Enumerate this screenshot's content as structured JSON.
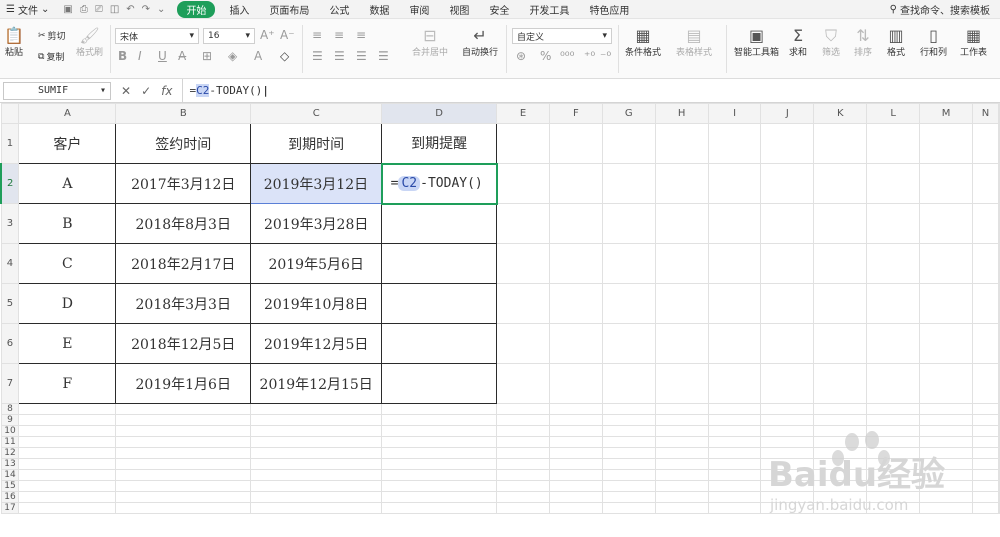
{
  "menubar": {
    "file_label": "文件",
    "tabs": [
      "开始",
      "插入",
      "页面布局",
      "公式",
      "数据",
      "审阅",
      "视图",
      "安全",
      "开发工具",
      "特色应用"
    ],
    "active_tab": "开始",
    "search_label": "查找命令、搜索模板"
  },
  "ribbon": {
    "paste": "粘贴",
    "cut": "剪切",
    "copy": "复制",
    "format_painter": "格式刷",
    "font_name": "宋体",
    "font_size": "16",
    "merge_center": "合并居中",
    "auto_wrap": "自动换行",
    "number_format": "自定义",
    "conditional_format": "条件格式",
    "table_style": "表格样式",
    "smart_toolbox": "智能工具箱",
    "sum": "求和",
    "filter": "筛选",
    "sort": "排序",
    "format": "格式",
    "rows_cols": "行和列",
    "worksheet": "工作表"
  },
  "formula_bar": {
    "name_box": "SUMIF",
    "cancel_icon": "✕",
    "confirm_icon": "✓",
    "fx": "fx",
    "formula_prefix": "=",
    "formula_ref": "C2",
    "formula_suffix": "-TODAY()"
  },
  "sheet": {
    "columns": [
      "A",
      "B",
      "C",
      "D",
      "E",
      "F",
      "G",
      "H",
      "I",
      "J",
      "K",
      "L",
      "M",
      "N"
    ],
    "rows": [
      "1",
      "2",
      "3",
      "4",
      "5",
      "6",
      "7",
      "8",
      "9",
      "10",
      "11",
      "12",
      "13",
      "14",
      "15",
      "16",
      "17"
    ],
    "header": [
      "客户",
      "签约时间",
      "到期时间",
      "到期提醒"
    ],
    "data": [
      [
        "A",
        "2017年3月12日",
        "2019年3月12日"
      ],
      [
        "B",
        "2018年8月3日",
        "2019年3月28日"
      ],
      [
        "C",
        "2018年2月17日",
        "2019年5月6日"
      ],
      [
        "D",
        "2018年3月3日",
        "2019年10月8日"
      ],
      [
        "E",
        "2018年12月5日",
        "2019年12月5日"
      ],
      [
        "F",
        "2019年1月6日",
        "2019年12月15日"
      ]
    ],
    "d2_prefix": "=",
    "d2_ref": "C2",
    "d2_suffix": "-TODAY()"
  },
  "watermark": {
    "brand": "Baidu经验",
    "url": "jingyan.baidu.com"
  }
}
